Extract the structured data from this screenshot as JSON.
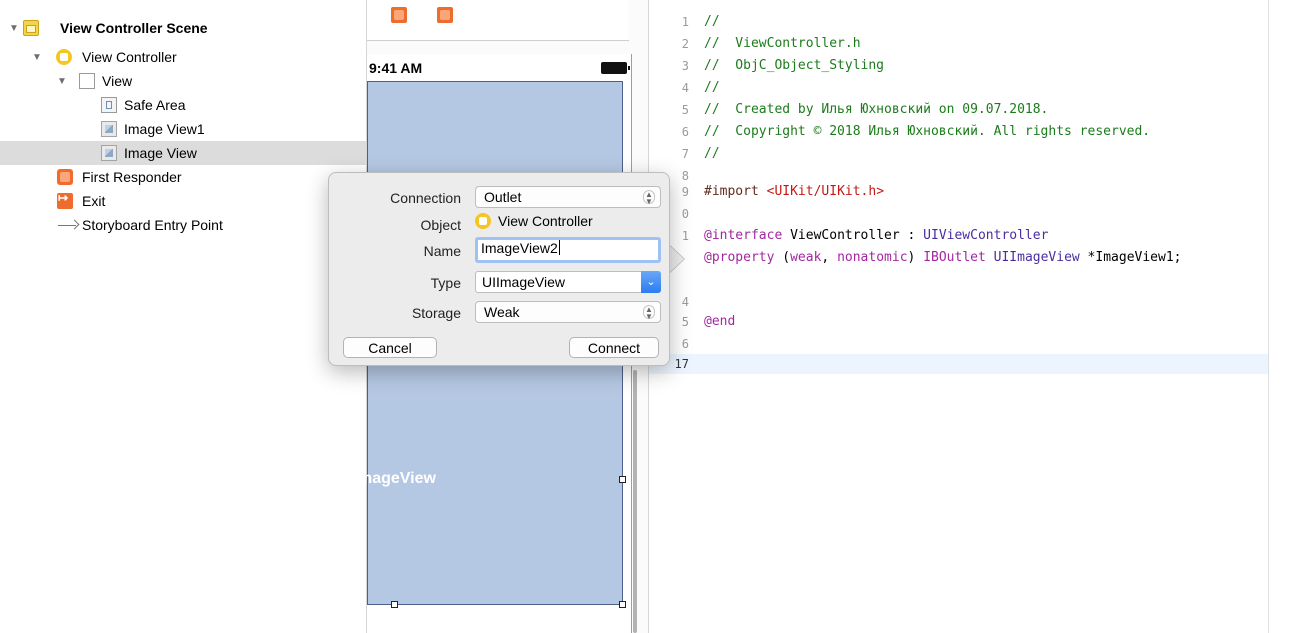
{
  "outline": {
    "items": [
      {
        "label": "View Controller Scene",
        "icon": "storyboard-scene-icon",
        "disclosure": "▼"
      },
      {
        "label": "View Controller",
        "icon": "view-controller-icon",
        "disclosure": "▼"
      },
      {
        "label": "View",
        "icon": "view-icon",
        "disclosure": "▼"
      },
      {
        "label": "Safe Area",
        "icon": "safe-area-icon"
      },
      {
        "label": "Image View1",
        "icon": "image-view-icon"
      },
      {
        "label": "Image View",
        "icon": "image-view-icon",
        "selected": true
      },
      {
        "label": "First Responder",
        "icon": "first-responder-icon"
      },
      {
        "label": "Exit",
        "icon": "exit-icon"
      },
      {
        "label": "Storyboard Entry Point",
        "icon": "entry-arrow-icon"
      }
    ]
  },
  "canvas": {
    "status_time": "9:41 AM",
    "image_view_label": "mageView"
  },
  "popover": {
    "connection_label": "Connection",
    "connection_value": "Outlet",
    "object_label": "Object",
    "object_value": "View Controller",
    "name_label": "Name",
    "name_value": "ImageView2",
    "type_label": "Type",
    "type_value": "UIImageView",
    "storage_label": "Storage",
    "storage_value": "Weak",
    "cancel_label": "Cancel",
    "connect_label": "Connect"
  },
  "editor": {
    "lines": [
      {
        "n": "1",
        "text": "//"
      },
      {
        "n": "2",
        "text": "//  ViewController.h"
      },
      {
        "n": "3",
        "text": "//  ObjC_Object_Styling"
      },
      {
        "n": "4",
        "text": "//"
      },
      {
        "n": "5",
        "text": "//  Created by Илья Юхновский on 09.07.2018."
      },
      {
        "n": "6",
        "text": "//  Copyright © 2018 Илья Юхновский. All rights reserved."
      },
      {
        "n": "7",
        "text": "//"
      },
      {
        "n": "8",
        "text": ""
      },
      {
        "n": "9",
        "pre": "#import ",
        "str": "<UIKit/UIKit.h>"
      },
      {
        "n": "0",
        "text": ""
      },
      {
        "n": "1",
        "kw": "@interface",
        "rest": " ViewController : ",
        "type": "UIViewController"
      },
      {
        "n": "",
        "kw1": "@property",
        "p1": " (",
        "kw2": "weak",
        "p2": ", ",
        "kw3": "nonatomic",
        "p3": ") ",
        "kw4": "IBOutlet",
        "p4": " ",
        "type": "UIImageView",
        "p5": " *ImageView1;"
      },
      {
        "n": "",
        "text": ""
      },
      {
        "n": "4",
        "text": ""
      },
      {
        "n": "5",
        "kw": "@end"
      },
      {
        "n": "6",
        "text": ""
      },
      {
        "n": "17",
        "text": ""
      }
    ]
  },
  "colors": {
    "comment": "#1c7c1c",
    "keyword": "#a327a0",
    "string": "#c41a16",
    "type": "#4a2ea0",
    "selection": "#dcdcdc",
    "image_view_fill": "#b5c8e3",
    "focus_ring": "#9ec3f3"
  }
}
